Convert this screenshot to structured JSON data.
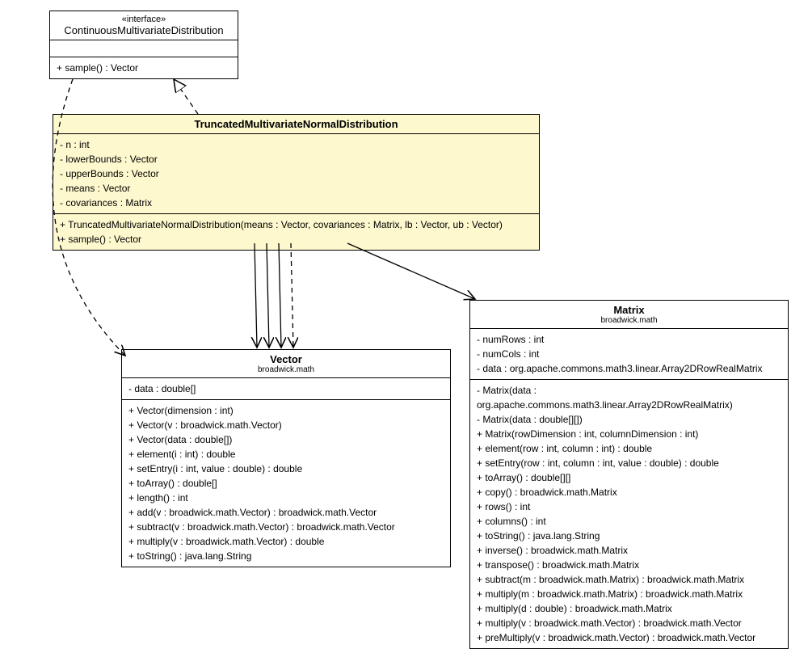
{
  "interface": {
    "stereotype": "«interface»",
    "name": "ContinuousMultivariateDistribution",
    "methods": [
      "+ sample() : Vector"
    ]
  },
  "truncated": {
    "name": "TruncatedMultivariateNormalDistribution",
    "attributes": [
      "- n : int",
      "- lowerBounds : Vector",
      "- upperBounds : Vector",
      "- means : Vector",
      "- covariances : Matrix"
    ],
    "methods": [
      "+ TruncatedMultivariateNormalDistribution(means : Vector, covariances : Matrix, lb : Vector, ub : Vector)",
      "+ sample() : Vector"
    ]
  },
  "vector": {
    "name": "Vector",
    "package": "broadwick.math",
    "attributes": [
      "- data : double[]"
    ],
    "methods": [
      "+ Vector(dimension : int)",
      "+ Vector(v : broadwick.math.Vector)",
      "+ Vector(data : double[])",
      "+ element(i : int) : double",
      "+ setEntry(i : int, value : double) : double",
      "+ toArray() : double[]",
      "+ length() : int",
      "+ add(v : broadwick.math.Vector) : broadwick.math.Vector",
      "+ subtract(v : broadwick.math.Vector) : broadwick.math.Vector",
      "+ multiply(v : broadwick.math.Vector) : double",
      "+ toString() : java.lang.String"
    ]
  },
  "matrix": {
    "name": "Matrix",
    "package": "broadwick.math",
    "attributes": [
      "- numRows : int",
      "- numCols : int",
      "- data : org.apache.commons.math3.linear.Array2DRowRealMatrix"
    ],
    "methods": [
      "- Matrix(data : org.apache.commons.math3.linear.Array2DRowRealMatrix)",
      "- Matrix(data : double[][])",
      "+ Matrix(rowDimension : int, columnDimension : int)",
      "+ element(row : int, column : int) : double",
      "+ setEntry(row : int, column : int, value : double) : double",
      "+ toArray() : double[][]",
      "+ copy() : broadwick.math.Matrix",
      "+ rows() : int",
      "+ columns() : int",
      "+ toString() : java.lang.String",
      "+ inverse() : broadwick.math.Matrix",
      "+ transpose() : broadwick.math.Matrix",
      "+ subtract(m : broadwick.math.Matrix) : broadwick.math.Matrix",
      "+ multiply(m : broadwick.math.Matrix) : broadwick.math.Matrix",
      "+ multiply(d : double) : broadwick.math.Matrix",
      "+ multiply(v : broadwick.math.Vector) : broadwick.math.Vector",
      "+ preMultiply(v : broadwick.math.Vector) : broadwick.math.Vector"
    ]
  }
}
